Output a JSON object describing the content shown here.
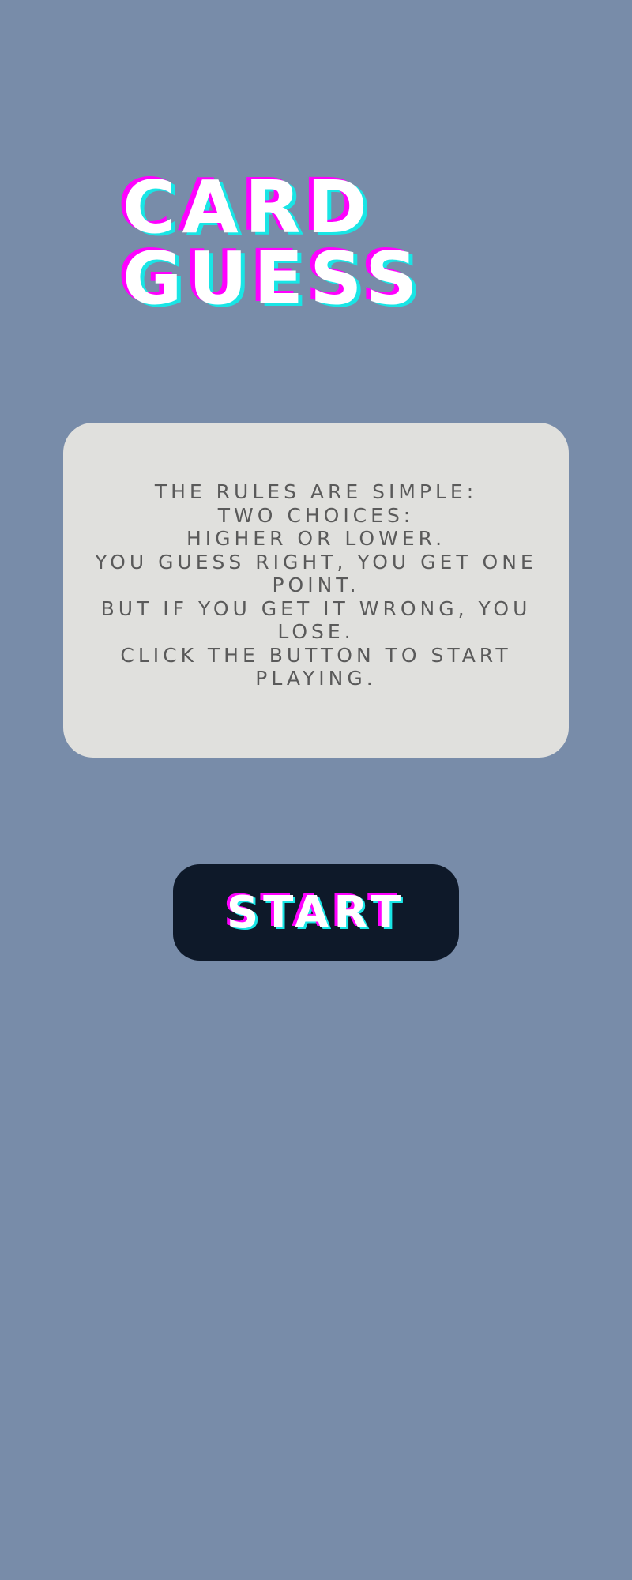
{
  "game": {
    "title_line1": "CARD",
    "title_line2": "GUESS"
  },
  "rules": {
    "lines": [
      "THE RULES ARE SIMPLE:",
      "TWO CHOICES:",
      "HIGHER OR LOWER.",
      "YOU GUESS RIGHT, YOU GET ONE POINT.",
      "BUT IF YOU GET IT WRONG, YOU LOSE.",
      "CLICK THE BUTTON TO START PLAYING."
    ]
  },
  "start_button": {
    "label": "START"
  },
  "colors": {
    "background": "#788ca9",
    "card": "#e0e0dd",
    "button": "#0e1929",
    "accent_magenta": "#ff00ff",
    "accent_cyan": "#19e5e5"
  }
}
